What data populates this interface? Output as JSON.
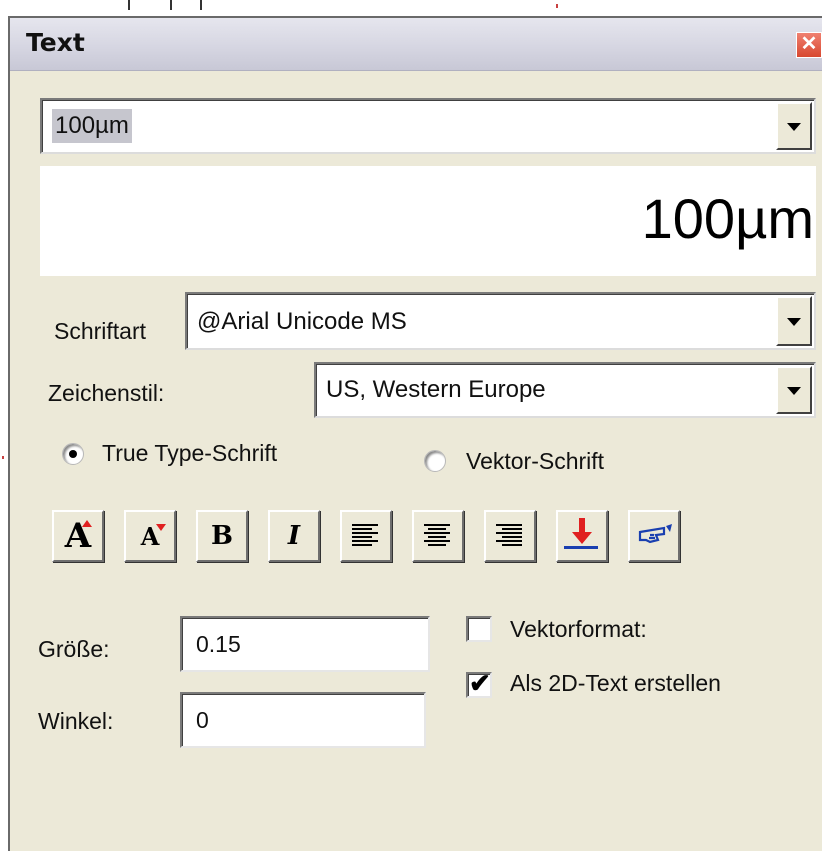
{
  "window": {
    "title": "Text",
    "close_glyph": "✕"
  },
  "text_input": {
    "value": "100µm"
  },
  "preview": {
    "text": "100µm"
  },
  "font": {
    "label": "Schriftart",
    "value": "@Arial Unicode MS"
  },
  "charset": {
    "label": "Zeichenstil:",
    "value": "US, Western Europe"
  },
  "font_type": {
    "options": [
      {
        "label": "True Type-Schrift",
        "selected": true
      },
      {
        "label": "Vektor-Schrift",
        "selected": false
      }
    ]
  },
  "toolbar": {
    "buttons": [
      {
        "icon": "increase-font-size-icon",
        "glyph": "A"
      },
      {
        "icon": "decrease-font-size-icon",
        "glyph": "A"
      },
      {
        "icon": "bold-icon",
        "glyph": "B"
      },
      {
        "icon": "italic-icon",
        "glyph": "I"
      },
      {
        "icon": "align-left-icon"
      },
      {
        "icon": "align-center-icon"
      },
      {
        "icon": "align-right-icon"
      },
      {
        "icon": "place-on-line-icon"
      },
      {
        "icon": "pointer-hand-icon"
      }
    ]
  },
  "size": {
    "label": "Größe:",
    "value": "0.15"
  },
  "angle": {
    "label": "Winkel:",
    "value": "0"
  },
  "vector_format": {
    "label": "Vektorformat:",
    "checked": false
  },
  "as_2d_text": {
    "label": "Als 2D-Text erstellen",
    "checked": true,
    "check_glyph": "✔"
  },
  "colors": {
    "accent_red": "#e02020",
    "highlight_blue": "#1a3fb0",
    "face": "#ece9d8"
  }
}
